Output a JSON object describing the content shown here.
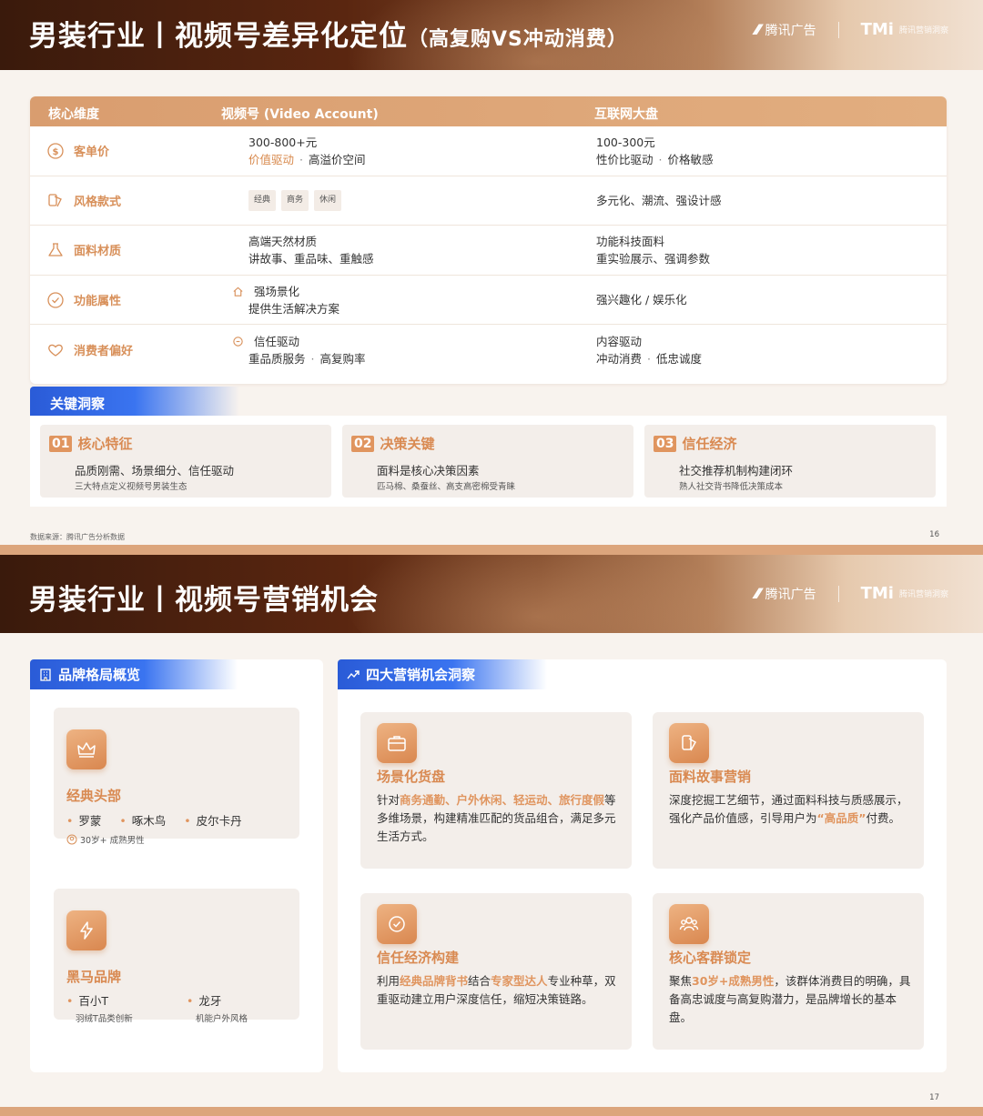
{
  "slide1": {
    "title": "男装行业丨视频号差异化定位",
    "subtitle": "（高复购VS冲动消费）",
    "logo_tencent": "腾讯广告",
    "logo_tmi": "TMi",
    "logo_tmi_text": "腾讯营销洞察",
    "table": {
      "headers": [
        "核心维度",
        "视频号 (Video Account)",
        "互联网大盘"
      ],
      "rows": [
        {
          "dim": "客单价",
          "icon": "dollar-icon",
          "v1": "300-800+元",
          "v2a": "价值驱动",
          "v2b": "高溢价空间",
          "i1": "100-300元",
          "i2a": "性价比驱动",
          "i2b": "价格敏感"
        },
        {
          "dim": "风格款式",
          "icon": "style-icon",
          "tags": [
            "经典",
            "商务",
            "休闲"
          ],
          "i1": "多元化、潮流、强设计感"
        },
        {
          "dim": "面料材质",
          "icon": "flask-icon",
          "v1": "高端天然材质",
          "v2": "讲故事、重品味、重触感",
          "i1": "功能科技面料",
          "i2": "重实验展示、强调参数"
        },
        {
          "dim": "功能属性",
          "icon": "check-circle-icon",
          "v1": "强场景化",
          "v2": "提供生活解决方案",
          "i1": "强兴趣化 / 娱乐化"
        },
        {
          "dim": "消费者偏好",
          "icon": "heart-icon",
          "v1": "信任驱动",
          "v2a": "重品质服务",
          "v2b": "高复购率",
          "i1": "内容驱动",
          "i2a": "冲动消费",
          "i2b": "低忠诚度"
        }
      ]
    },
    "insight_label": "关键洞察",
    "insights": [
      {
        "num": "01",
        "title": "核心特征",
        "main": "品质刚需、场景细分、信任驱动",
        "sub": "三大特点定义视频号男装生态"
      },
      {
        "num": "02",
        "title": "决策关键",
        "main": "面料是核心决策因素",
        "sub": "匹马棉、桑蚕丝、高支高密棉受青睐"
      },
      {
        "num": "03",
        "title": "信任经济",
        "main": "社交推荐机制构建闭环",
        "sub": "熟人社交背书降低决策成本"
      }
    ],
    "source": "数据来源：腾讯广告分析数据",
    "page": "16"
  },
  "slide2": {
    "title": "男装行业丨视频号营销机会",
    "logo_tencent": "腾讯广告",
    "logo_tmi": "TMi",
    "logo_tmi_text": "腾讯营销洞察",
    "left_label": "品牌格局概览",
    "right_label": "四大营销机会洞察",
    "classic": {
      "title": "经典头部",
      "brands": [
        "罗蒙",
        "啄木鸟",
        "皮尔卡丹"
      ],
      "note": "30岁+ 成熟男性"
    },
    "darkhorse": {
      "title": "黑马品牌",
      "b1": "百小T",
      "b1_desc": "羽绒T品类创新",
      "b2": "龙牙",
      "b2_desc": "机能户外风格"
    },
    "opps": [
      {
        "title": "场景化货盘",
        "t1": "针对",
        "h1": "商务通勤、户外休闲、轻运动、旅行度假",
        "t2": "等多维场景，构建精准匹配的货品组合，满足多元生活方式。"
      },
      {
        "title": "面料故事营销",
        "t1": "深度挖掘工艺细节，通过面料科技与质感展示，强化产品价值感，引导用户为",
        "h1": "“高品质”",
        "t2": "付费。"
      },
      {
        "title": "信任经济构建",
        "t1": "利用",
        "h1": "经典品牌背书",
        "t2": "结合",
        "h2": "专家型达人",
        "t3": "专业种草，双重驱动建立用户深度信任，缩短决策链路。"
      },
      {
        "title": "核心客群锁定",
        "t1": "聚焦",
        "h1": "30岁+成熟男性",
        "t2": "，该群体消费目的明确，具备高忠诚度与高复购潜力，是品牌增长的基本盘。"
      }
    ],
    "page": "17"
  },
  "colors": {
    "accent": "#d98a52",
    "blue": "#2a5bd7",
    "header_dark": "#3a1a0c"
  }
}
